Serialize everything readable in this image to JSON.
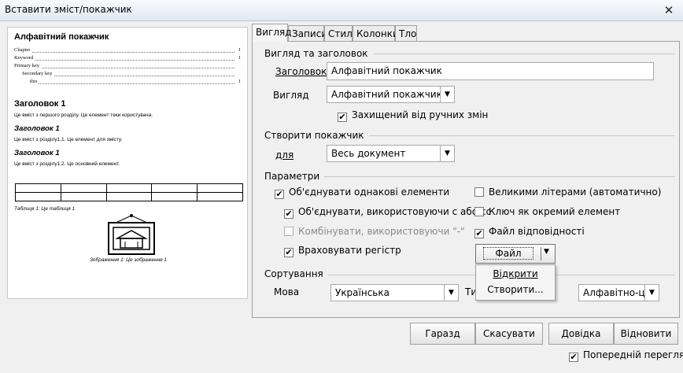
{
  "window": {
    "title": "Вставити зміст/покажчик",
    "close_glyph": "✕"
  },
  "preview": {
    "heading": "Алфавітний покажчик",
    "entries": [
      {
        "text": "Chapter",
        "page": "1"
      },
      {
        "text": "Keyword",
        "page": "1"
      },
      {
        "text": "Primary key",
        "page": ""
      },
      {
        "text": "Secondary key",
        "page": ""
      },
      {
        "text": "this",
        "page": "1"
      }
    ],
    "h1": "Заголовок 1",
    "h1_text": "Це вміст з першого розділу. Це елемент теки користувача.",
    "h1_1": "Заголовок 1",
    "h1_1_text": "Це вміст з розділу1.1. Це елемент для змісту.",
    "h1_2": "Заголовок 1",
    "h1_2_text": "Це вміст з розділу1.2. Це основний елемент.",
    "table_caption": "Таблиця 1: Це таблиця 1",
    "image_caption": "Зображення 1: Це зображення 1"
  },
  "tabs": [
    "Вигляд",
    "Записи",
    "Стилі",
    "Колонки",
    "Тло"
  ],
  "type_section": {
    "title": "Вигляд та заголовок",
    "title_label": "Заголовок",
    "title_value": "Алфавітний покажчик",
    "type_label": "Вигляд",
    "type_value": "Алфавітний покажчик",
    "protected_label": "Захищений від ручних змін",
    "protected_checked": true
  },
  "create_section": {
    "title": "Створити покажчик",
    "for_label": "для",
    "for_value": "Весь документ"
  },
  "options_section": {
    "title": "Параметри",
    "combine_identical": {
      "label": "Об'єднувати однакові елементи",
      "checked": true
    },
    "combine_pp": {
      "label": "Об'єднувати, використовуючи с або сс",
      "checked": true
    },
    "combine_dash": {
      "label": "Комбінувати, використовуючи \"-\"",
      "checked": false,
      "disabled": true
    },
    "case_sensitive": {
      "label": "Враховувати регістр",
      "checked": true
    },
    "auto_capitalize": {
      "label": "Великими літерами (автоматично)",
      "checked": false
    },
    "keys_separate": {
      "label": "Ключ як окремий елемент",
      "checked": false
    },
    "concordance": {
      "label": "Файл відповідності",
      "checked": true
    },
    "file_button": "Файл",
    "file_menu": [
      "Відкрити",
      "Створити..."
    ]
  },
  "sort_section": {
    "title": "Сортування",
    "lang_label": "Мова",
    "lang_value": "Українська",
    "type_label": "Ти",
    "type_value": "Алфавітно-циф"
  },
  "buttons": {
    "ok": "Гаразд",
    "cancel": "Скасувати",
    "help": "Довідка",
    "reset": "Відновити"
  },
  "preview_toggle": {
    "label": "Попередній перегляд",
    "checked": true
  },
  "glyphs": {
    "check": "✔",
    "down_arrow": "▼"
  }
}
